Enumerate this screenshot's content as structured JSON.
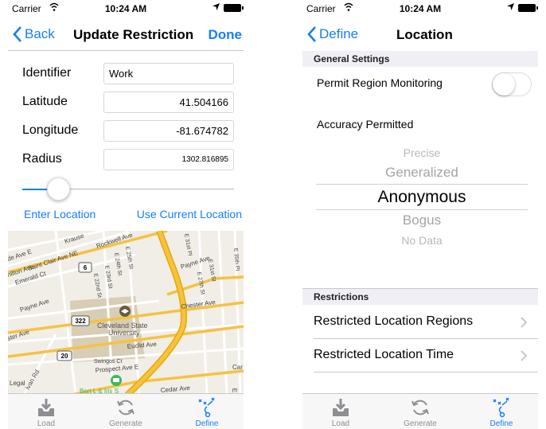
{
  "status": {
    "carrier": "Carrier",
    "time": "10:24 AM"
  },
  "left": {
    "nav": {
      "back": "Back",
      "title": "Update Restriction",
      "done": "Done"
    },
    "fields": [
      {
        "label": "Identifier",
        "value": "Work"
      },
      {
        "label": "Latitude",
        "value": "41.504166"
      },
      {
        "label": "Longitude",
        "value": "-81.674782"
      },
      {
        "label": "Radius",
        "value": "1302.816895"
      }
    ],
    "slider_fraction": 0.17,
    "links": {
      "enter_location": "Enter Location",
      "use_current": "Use Current Location"
    },
    "map_labels": {
      "rockwell": "Rockwell Ave",
      "krause": "Krause",
      "de_ave_e": "de Ave E",
      "saint_clair": "Saint Clair Ave NE",
      "hamilton": "nilton Ave",
      "emerald": "Emerald Ct",
      "e22": "E 22nd St",
      "e23": "E 23rd St",
      "e24": "E 24th St",
      "e25": "E 25th St",
      "e31": "E 31st Pl",
      "e31st": "E 31st St",
      "e27": "E 27th St",
      "e35": "E 35th Pl",
      "payne_e": "Payne Ave",
      "payne_w": "Payne Ave",
      "chester": "Chester Ave",
      "csu1": "Cleveland State",
      "csu2": "University",
      "euclid": "Euclid Ave",
      "swingos": "Swingos Ct",
      "prospect": "Prospect Ave E",
      "cedar": "Cedar Ave",
      "ster": "ster Ave",
      "legal": "Legal",
      "ivan": "ivan Rd",
      "bert": "Bert L & Iris S",
      "car": "Car",
      "e3": "E 3",
      "route_6": "6",
      "route_322": "322",
      "route_20": "20"
    }
  },
  "right": {
    "nav": {
      "back": "Define",
      "title": "Location"
    },
    "general_header": "General Settings",
    "permit_label": "Permit Region Monitoring",
    "permit_on": false,
    "accuracy_label": "Accuracy Permitted",
    "picker": [
      "Precise",
      "Generalized",
      "Anonymous",
      "Bogus",
      "No Data"
    ],
    "restrictions_header": "Restrictions",
    "restriction_items": [
      "Restricted Location Regions",
      "Restricted Location Time"
    ]
  },
  "tabs": [
    {
      "label": "Load",
      "icon": "tray-download-icon"
    },
    {
      "label": "Generate",
      "icon": "refresh-icon"
    },
    {
      "label": "Define",
      "icon": "play-diagram-icon",
      "selected": true
    }
  ],
  "colors": {
    "accent": "#157efb",
    "section_bg": "#f0eff5",
    "tab_inactive": "#8e8e93",
    "highway": "#f5c242",
    "campus": "#d8cdb5",
    "park_green": "#3fb85c"
  }
}
